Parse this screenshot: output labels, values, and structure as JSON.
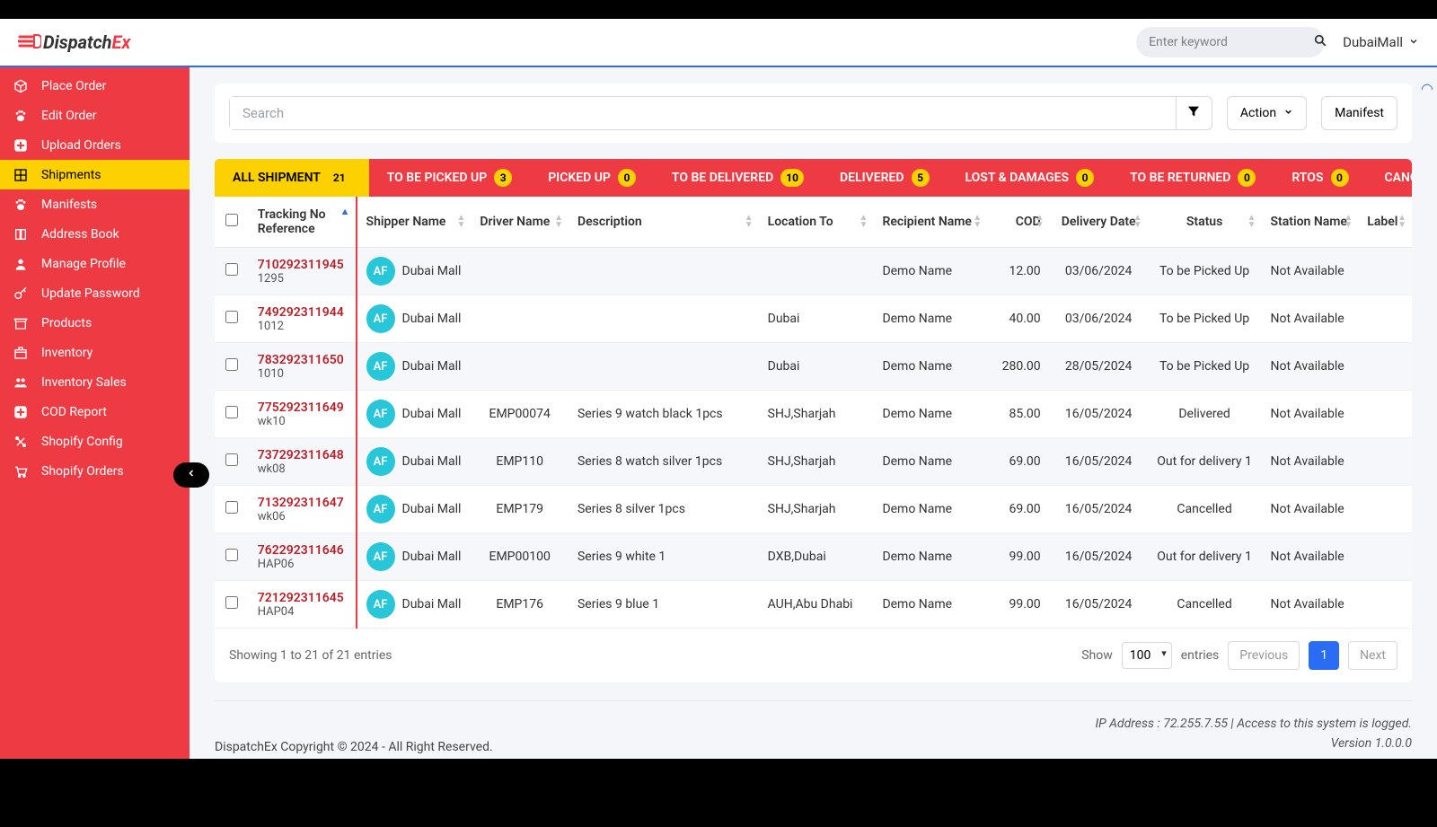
{
  "brand": {
    "name1": "Dispatch",
    "name2": "Ex"
  },
  "header": {
    "search_placeholder": "Enter keyword",
    "user_label": "DubaiMall"
  },
  "sidebar": {
    "items": [
      {
        "label": "Place Order",
        "icon": "cube-icon"
      },
      {
        "label": "Edit Order",
        "icon": "paw-icon"
      },
      {
        "label": "Upload Orders",
        "icon": "plus-icon"
      },
      {
        "label": "Shipments",
        "icon": "grid-icon",
        "active": true
      },
      {
        "label": "Manifests",
        "icon": "paw-icon"
      },
      {
        "label": "Address Book",
        "icon": "book-icon"
      },
      {
        "label": "Manage Profile",
        "icon": "user-icon"
      },
      {
        "label": "Update Password",
        "icon": "key-icon"
      },
      {
        "label": "Products",
        "icon": "store-icon"
      },
      {
        "label": "Inventory",
        "icon": "box-icon"
      },
      {
        "label": "Inventory Sales",
        "icon": "users-icon"
      },
      {
        "label": "COD Report",
        "icon": "plus-icon"
      },
      {
        "label": "Shopify Config",
        "icon": "tools-icon"
      },
      {
        "label": "Shopify Orders",
        "icon": "cart-icon"
      }
    ]
  },
  "toolbar": {
    "search_placeholder": "Search",
    "action_label": "Action",
    "manifest_label": "Manifest"
  },
  "tabs": [
    {
      "label": "ALL SHIPMENT",
      "count": "21",
      "active": true
    },
    {
      "label": "TO BE PICKED UP",
      "count": "3"
    },
    {
      "label": "PICKED UP",
      "count": "0"
    },
    {
      "label": "TO BE DELIVERED",
      "count": "10"
    },
    {
      "label": "DELIVERED",
      "count": "5"
    },
    {
      "label": "LOST & DAMAGES",
      "count": "0"
    },
    {
      "label": "TO BE RETURNED",
      "count": "0"
    },
    {
      "label": "RTOS",
      "count": "0"
    },
    {
      "label": "CANCELED",
      "count": ""
    }
  ],
  "columns": {
    "tracking": "Tracking No",
    "reference": "Reference",
    "shipper": "Shipper Name",
    "driver": "Driver Name",
    "description": "Description",
    "location": "Location To",
    "recipient": "Recipient Name",
    "cod": "COD",
    "delivery_date": "Delivery Date",
    "status": "Status",
    "station": "Station Name",
    "label": "Label"
  },
  "avatar_initials": "AF",
  "shipper_name": "Dubai Mall",
  "rows": [
    {
      "track": "710292311945",
      "ref": "1295",
      "driver": "",
      "desc": "",
      "loc": "",
      "recip": "Demo Name",
      "cod": "12.00",
      "date": "03/06/2024",
      "status": "To be Picked Up",
      "station": "Not Available"
    },
    {
      "track": "749292311944",
      "ref": "1012",
      "driver": "",
      "desc": "",
      "loc": "Dubai",
      "recip": "Demo Name",
      "cod": "40.00",
      "date": "03/06/2024",
      "status": "To be Picked Up",
      "station": "Not Available"
    },
    {
      "track": "783292311650",
      "ref": "1010",
      "driver": "",
      "desc": "",
      "loc": "Dubai",
      "recip": "Demo Name",
      "cod": "280.00",
      "date": "28/05/2024",
      "status": "To be Picked Up",
      "station": "Not Available"
    },
    {
      "track": "775292311649",
      "ref": "wk10",
      "driver": "EMP00074",
      "desc": "Series 9 watch black 1pcs",
      "loc": "SHJ,Sharjah",
      "recip": "Demo Name",
      "cod": "85.00",
      "date": "16/05/2024",
      "status": "Delivered",
      "station": "Not Available"
    },
    {
      "track": "737292311648",
      "ref": "wk08",
      "driver": "EMP110",
      "desc": "Series 8 watch silver 1pcs",
      "loc": "SHJ,Sharjah",
      "recip": "Demo Name",
      "cod": "69.00",
      "date": "16/05/2024",
      "status": "Out for delivery 1",
      "station": "Not Available"
    },
    {
      "track": "713292311647",
      "ref": "wk06",
      "driver": "EMP179",
      "desc": "Series 8 silver 1pcs",
      "loc": "SHJ,Sharjah",
      "recip": "Demo Name",
      "cod": "69.00",
      "date": "16/05/2024",
      "status": "Cancelled",
      "station": "Not Available"
    },
    {
      "track": "762292311646",
      "ref": "HAP06",
      "driver": "EMP00100",
      "desc": "Series 9 white 1",
      "loc": "DXB,Dubai",
      "recip": "Demo Name",
      "cod": "99.00",
      "date": "16/05/2024",
      "status": "Out for delivery 1",
      "station": "Not Available"
    },
    {
      "track": "721292311645",
      "ref": "HAP04",
      "driver": "EMP176",
      "desc": "Series 9 blue 1",
      "loc": "AUH,Abu Dhabi",
      "recip": "Demo Name",
      "cod": "99.00",
      "date": "16/05/2024",
      "status": "Cancelled",
      "station": "Not Available"
    }
  ],
  "footer": {
    "showing": "Showing 1 to 21 of 21 entries",
    "show_label": "Show",
    "entries_label": "entries",
    "page_size": "100",
    "prev": "Previous",
    "next": "Next",
    "current": "1"
  },
  "page_footer": {
    "copyright": "DispatchEx Copyright © 2024 - All Right Reserved.",
    "ip": "IP Address : 72.255.7.55 | Access to this system is logged.",
    "version": "Version 1.0.0.0"
  }
}
